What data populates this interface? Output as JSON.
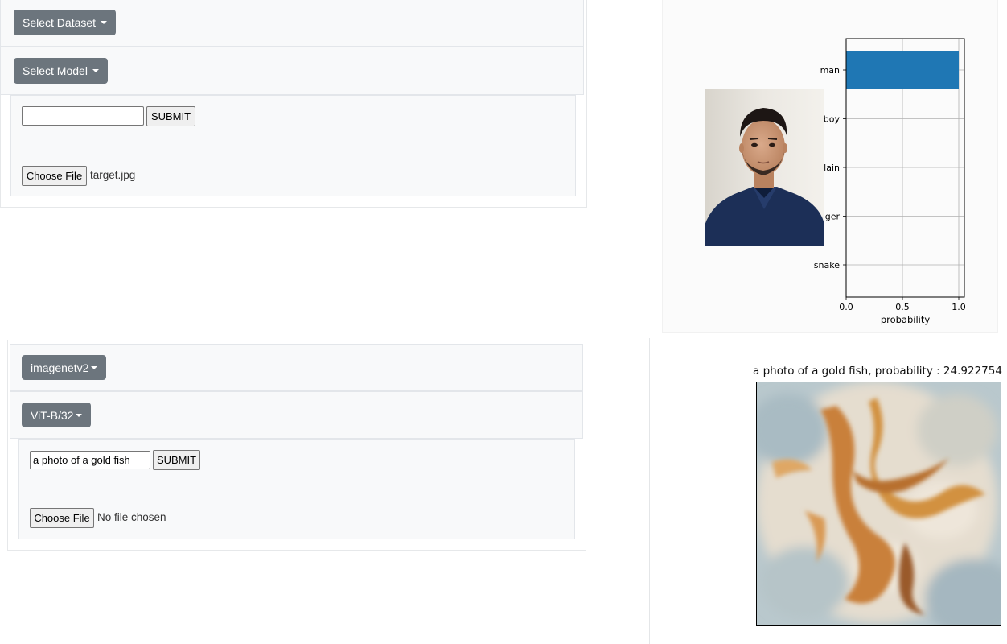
{
  "top": {
    "dataset_dropdown": "Select Dataset",
    "model_dropdown": "Select Model",
    "text_input": {
      "value": "",
      "placeholder": ""
    },
    "submit_label": "SUBMIT",
    "file_button_label": "Choose File",
    "file_name": "target.jpg"
  },
  "bottom": {
    "dataset_dropdown": "imagenetv2",
    "model_dropdown": "ViT-B/32",
    "text_input": {
      "value": "a photo of a gold fish",
      "placeholder": ""
    },
    "submit_label": "SUBMIT",
    "file_button_label": "Choose File",
    "file_name": "No file chosen"
  },
  "result_bottom": {
    "caption": "a photo of a gold fish, probability : 24.922754"
  },
  "chart_data": {
    "type": "bar",
    "orientation": "horizontal",
    "categories": [
      "man",
      "boy",
      "plain",
      "tiger",
      "snake"
    ],
    "values": [
      1.0,
      0.0,
      0.0,
      0.0,
      0.0
    ],
    "xlabel": "probability",
    "ylabel": "",
    "xlim": [
      0,
      1.05
    ],
    "xticks": [
      "0.0",
      "0.5",
      "1.0"
    ],
    "grid": true,
    "bar_color": "#1f77b4"
  }
}
